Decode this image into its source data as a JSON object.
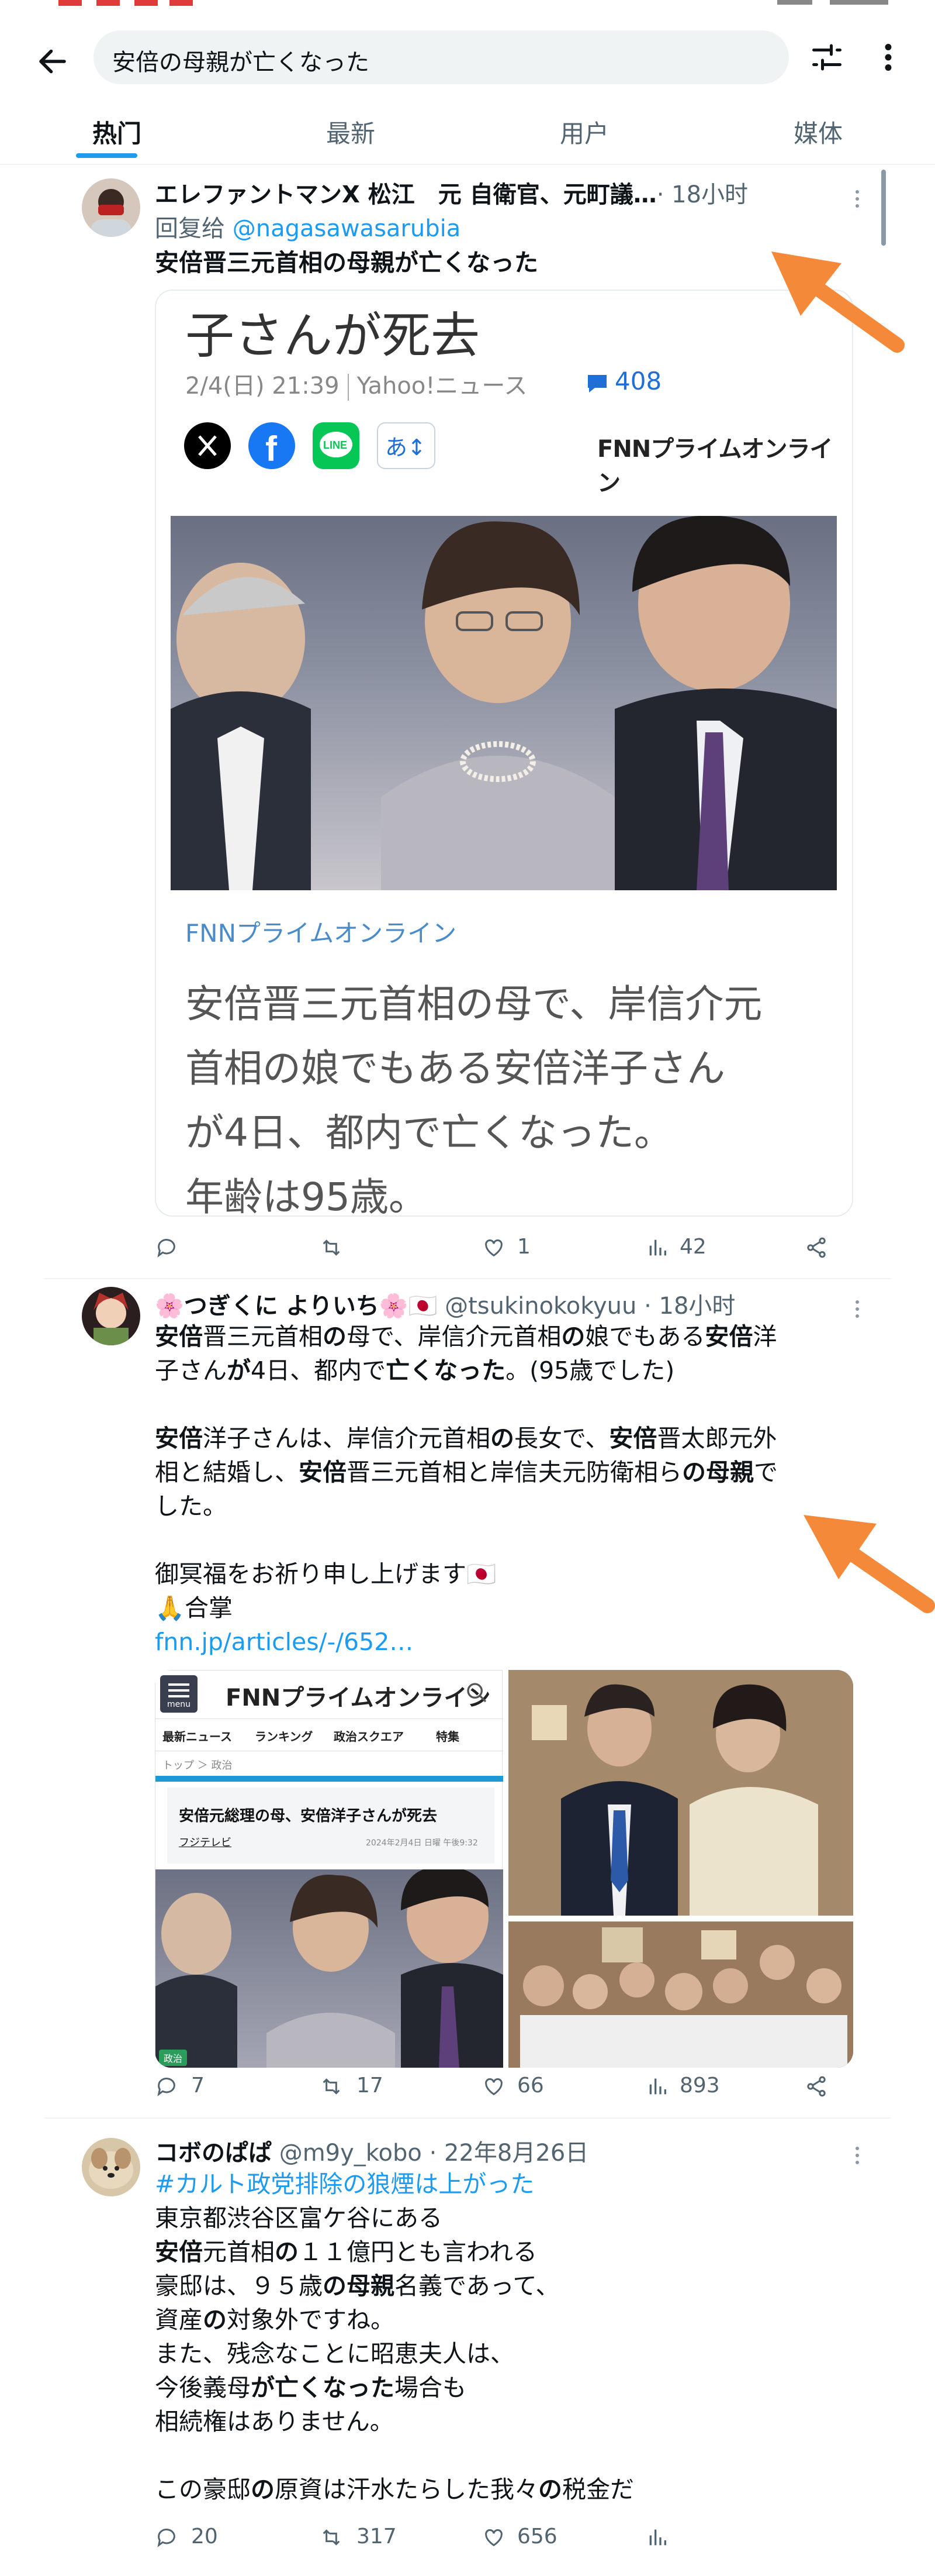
{
  "search": {
    "query": "安倍の母親が亡くなった"
  },
  "tabs": [
    {
      "label": "热门"
    },
    {
      "label": "最新"
    },
    {
      "label": "用户"
    },
    {
      "label": "媒体"
    }
  ],
  "tweet1": {
    "name": "エレファントマンX 松江　元 自衛官、元町議…",
    "time": "· 18小时",
    "reply_prefix": "回复给 ",
    "reply_handle": "@nagasawasarubia",
    "text_bold_1": "安倍",
    "text_1": "晋三元首相",
    "text_bold_2": "の母親が亡くなった",
    "card": {
      "headline": "子さんが死去",
      "date": "2/4(日) 21:39",
      "source": "Yahoo!ニュース",
      "comments": "408",
      "brand": "FNNプライムオンライン",
      "link_label": "FNNプライムオンライン",
      "body_lines": [
        "安倍晋三元首相の母で、岸信介元",
        "首相の娘でもある安倍洋子さん",
        "が4日、都内で亡くなった。",
        "年齢は95歳。"
      ]
    },
    "actions": {
      "likes": "1",
      "views": "42"
    }
  },
  "tweet2": {
    "name": "🌸つぎくに よりいち🌸🇯🇵",
    "handle": "@tsukinokokyuu · 18小时",
    "para1_lines": [
      [
        [
          "安倍",
          true
        ],
        [
          "晋三元首相",
          false
        ],
        [
          "の",
          true
        ],
        [
          "母で、岸信介元首相",
          false
        ],
        [
          "の",
          true
        ],
        [
          "娘でもある",
          false
        ],
        [
          "安倍",
          true
        ],
        [
          "洋",
          false
        ]
      ],
      [
        [
          "子さん",
          false
        ],
        [
          "が",
          true
        ],
        [
          "4日、都内で",
          false
        ],
        [
          "亡くなった",
          true
        ],
        [
          "。(95歳でした)",
          false
        ]
      ]
    ],
    "para2_lines": [
      [
        [
          "安倍",
          true
        ],
        [
          "洋子さんは、岸信介元首相",
          false
        ],
        [
          "の",
          true
        ],
        [
          "長女で、",
          false
        ],
        [
          "安倍",
          true
        ],
        [
          "晋太郎元外",
          false
        ]
      ],
      [
        [
          "相と結婚し、",
          false
        ],
        [
          "安倍",
          true
        ],
        [
          "晋三元首相と岸信夫元防衛相ら",
          false
        ],
        [
          "の母親",
          true
        ],
        [
          "で",
          false
        ]
      ],
      [
        [
          "した。",
          false
        ]
      ]
    ],
    "line3": "御冥福をお祈り申し上げます🇯🇵",
    "line4": "🙏合掌",
    "link": "fnn.jp/articles/-/652…",
    "media1": {
      "brand": "FNNプライムオンライン",
      "menu": "menu",
      "nav": [
        "最新ニュース",
        "ランキング",
        "政治スクエア",
        "特集"
      ],
      "crumb": "トップ ＞ 政治",
      "headline": "安倍元総理の母、安倍洋子さんが死去",
      "source": "フジテレビ",
      "date": "2024年2月4日 日曜 午後9:32",
      "tag": "政治"
    },
    "actions": {
      "replies": "7",
      "retweets": "17",
      "likes": "66",
      "views": "893"
    }
  },
  "tweet3": {
    "name": "コボのぱぱ",
    "handle": "@m9y_kobo · 22年8月26日",
    "hashtag": "#カルト政党排除の狼煙は上がった",
    "lines": [
      [
        [
          "東京都渋谷区富ケ谷にある",
          false
        ]
      ],
      [
        [
          "安倍",
          true
        ],
        [
          "元首相",
          false
        ],
        [
          "の",
          true
        ],
        [
          "１１億円とも言われる",
          false
        ]
      ],
      [
        [
          "豪邸は、９５歳",
          false
        ],
        [
          "の母親",
          true
        ],
        [
          "名義であって、",
          false
        ]
      ],
      [
        [
          "資産",
          false
        ],
        [
          "の",
          true
        ],
        [
          "対象外ですね。",
          false
        ]
      ],
      [
        [
          "また、残念なことに昭恵夫人は、",
          false
        ]
      ],
      [
        [
          "今後義母",
          false
        ],
        [
          "が亡くなった",
          true
        ],
        [
          "場合も",
          false
        ]
      ],
      [
        [
          "相続権はありません。",
          false
        ]
      ],
      [
        [
          "",
          false
        ]
      ],
      [
        [
          "この豪邸",
          false
        ],
        [
          "の",
          true
        ],
        [
          "原資は汗水たらした我々",
          false
        ],
        [
          "の",
          true
        ],
        [
          "税金だ",
          false
        ]
      ]
    ],
    "actions": {
      "replies": "20",
      "retweets": "317",
      "likes": "656"
    }
  },
  "colors": {
    "accent": "#1d9bf0",
    "arrow": "#f5893a",
    "text": "#0f1419",
    "muted": "#536471"
  }
}
